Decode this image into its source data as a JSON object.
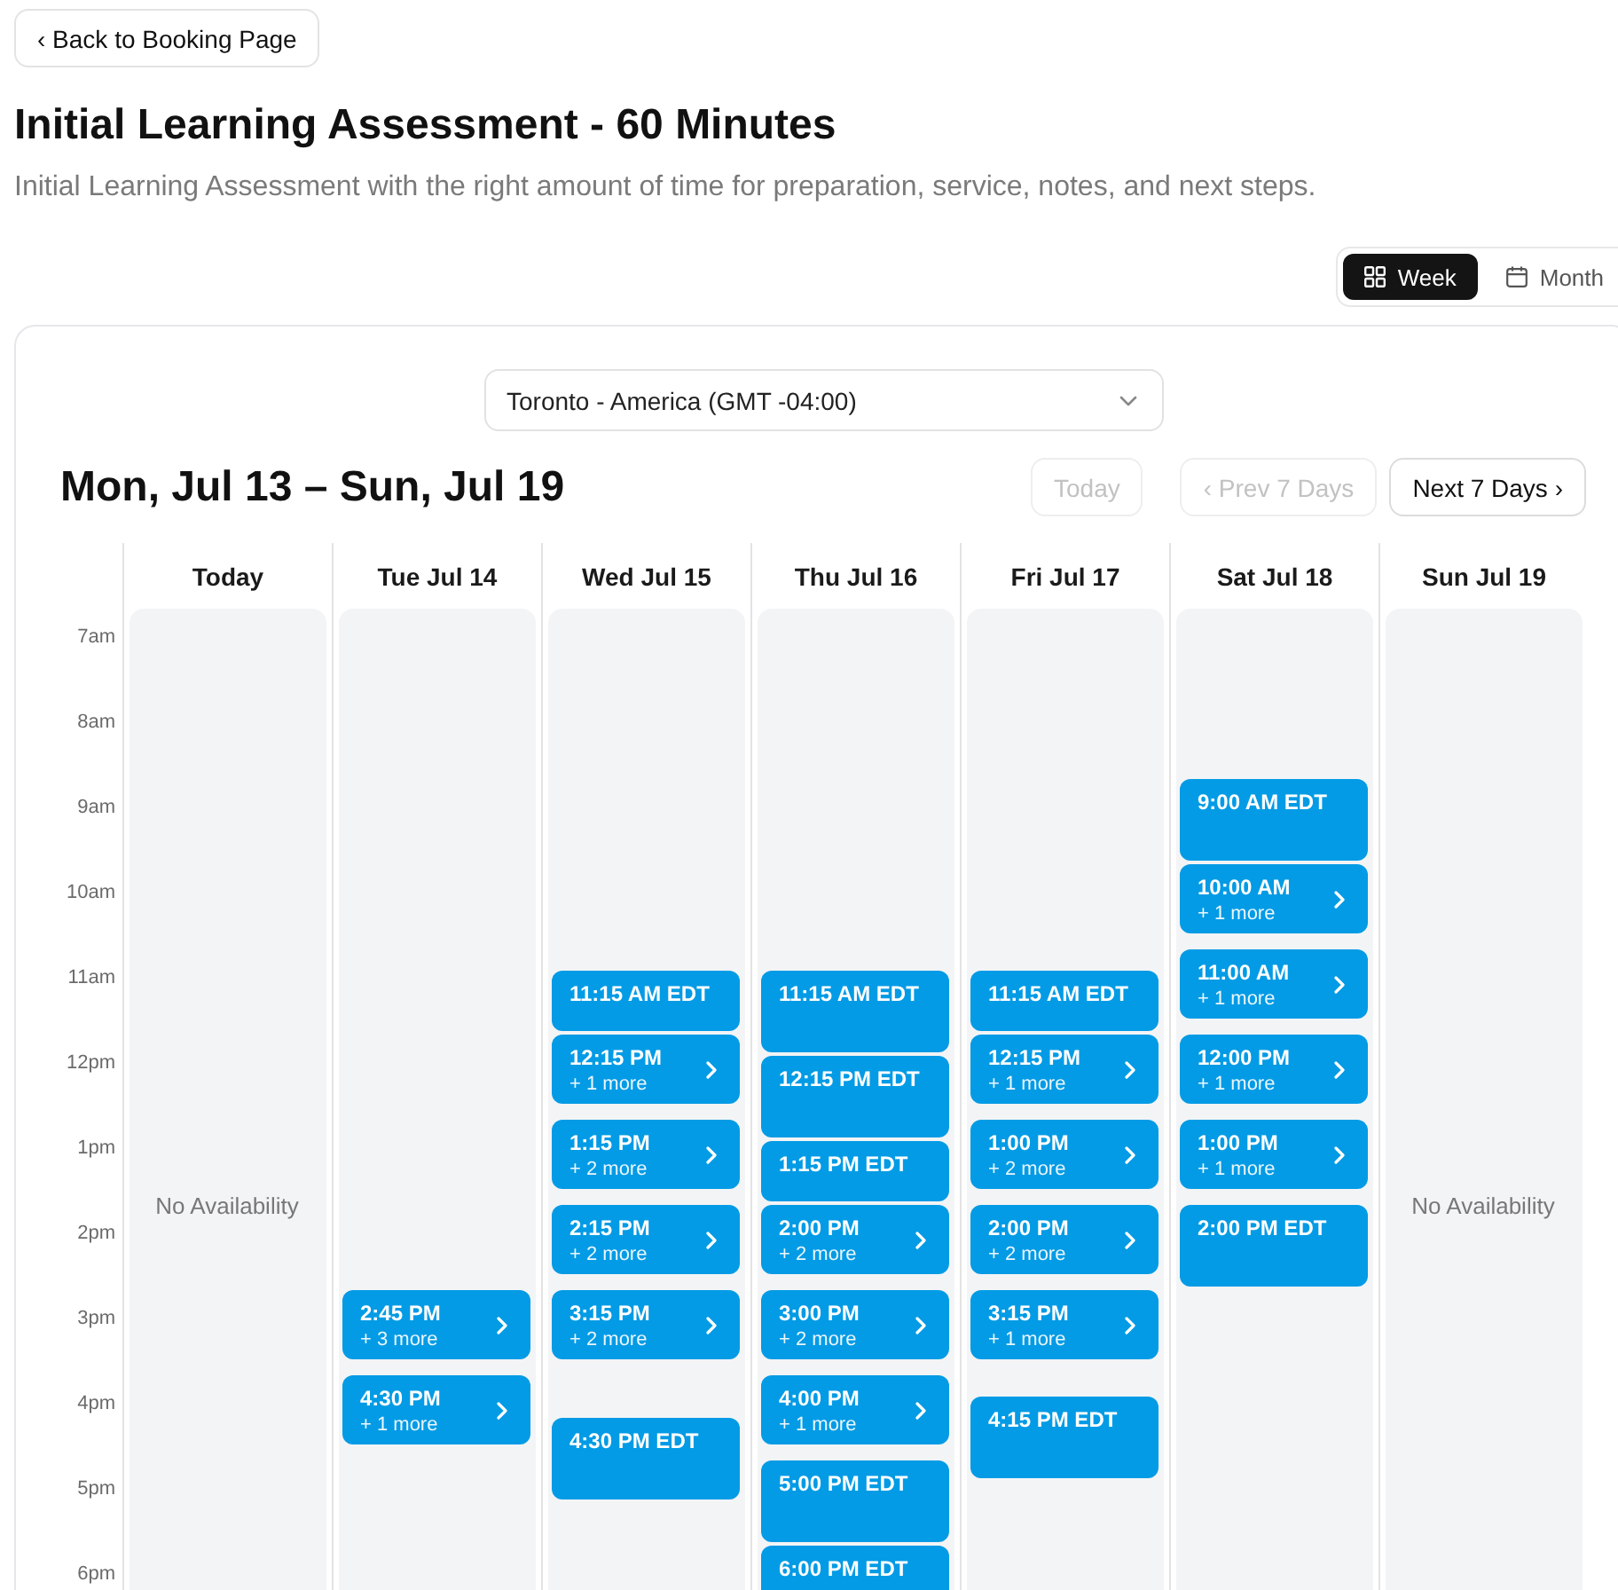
{
  "back_button": {
    "label": "‹ Back to Booking Page"
  },
  "title": "Initial Learning Assessment - 60 Minutes",
  "description": "Initial Learning Assessment with the right amount of time for preparation, service, notes, and next steps.",
  "view_toggle": [
    {
      "label": "Week",
      "selected": true
    },
    {
      "label": "Month",
      "selected": false
    }
  ],
  "calendar": {
    "timezone": {
      "value": "Toronto - America (GMT -04:00)"
    },
    "range_heading": "Mon, Jul 13 – Sun, Jul 19",
    "nav_buttons": [
      {
        "label": "Today",
        "disabled": true
      },
      {
        "label": "‹ Prev 7 Days",
        "disabled": true
      },
      {
        "label": "Next 7 Days ›",
        "disabled": false
      }
    ],
    "hours": [
      "7am",
      "8am",
      "9am",
      "10am",
      "11am",
      "12pm",
      "1pm",
      "2pm",
      "3pm",
      "4pm",
      "5pm",
      "6pm"
    ],
    "days": [
      {
        "heading": "Today",
        "empty_text": "No Availability"
      },
      {
        "heading": "Tue Jul 14",
        "slots": [
          {
            "kind": "group",
            "time": "2:45 PM",
            "more": "+ 3 more"
          },
          {
            "kind": "group",
            "time": "4:30 PM",
            "more": "+ 1 more"
          }
        ]
      },
      {
        "heading": "Wed Jul 15",
        "slots": [
          {
            "kind": "single",
            "time": "11:15 AM EDT"
          },
          {
            "kind": "group",
            "time": "12:15 PM",
            "more": "+ 1 more"
          },
          {
            "kind": "group",
            "time": "1:15 PM",
            "more": "+ 2 more"
          },
          {
            "kind": "group",
            "time": "2:15 PM",
            "more": "+ 2 more"
          },
          {
            "kind": "group",
            "time": "3:15 PM",
            "more": "+ 2 more"
          },
          {
            "kind": "single",
            "time": "4:30 PM EDT"
          }
        ]
      },
      {
        "heading": "Thu Jul 16",
        "slots": [
          {
            "kind": "single",
            "time": "11:15 AM EDT"
          },
          {
            "kind": "single",
            "time": "12:15 PM EDT"
          },
          {
            "kind": "single",
            "time": "1:15 PM EDT"
          },
          {
            "kind": "group",
            "time": "2:00 PM",
            "more": "+ 2 more"
          },
          {
            "kind": "group",
            "time": "3:00 PM",
            "more": "+ 2 more"
          },
          {
            "kind": "group",
            "time": "4:00 PM",
            "more": "+ 1 more"
          },
          {
            "kind": "single",
            "time": "5:00 PM EDT"
          },
          {
            "kind": "single",
            "time": "6:00 PM EDT"
          }
        ]
      },
      {
        "heading": "Fri Jul 17",
        "slots": [
          {
            "kind": "single",
            "time": "11:15 AM EDT"
          },
          {
            "kind": "group",
            "time": "12:15 PM",
            "more": "+ 1 more"
          },
          {
            "kind": "group",
            "time": "1:00 PM",
            "more": "+ 2 more"
          },
          {
            "kind": "group",
            "time": "2:00 PM",
            "more": "+ 2 more"
          },
          {
            "kind": "group",
            "time": "3:15 PM",
            "more": "+ 1 more"
          },
          {
            "kind": "single",
            "time": "4:15 PM EDT"
          }
        ]
      },
      {
        "heading": "Sat Jul 18",
        "slots": [
          {
            "kind": "single",
            "time": "9:00 AM EDT"
          },
          {
            "kind": "group",
            "time": "10:00 AM",
            "more": "+ 1 more"
          },
          {
            "kind": "group",
            "time": "11:00 AM",
            "more": "+ 1 more"
          },
          {
            "kind": "group",
            "time": "12:00 PM",
            "more": "+ 1 more"
          },
          {
            "kind": "group",
            "time": "1:00 PM",
            "more": "+ 1 more"
          },
          {
            "kind": "single",
            "time": "2:00 PM EDT"
          }
        ]
      },
      {
        "heading": "Sun Jul 19",
        "empty_text": "No Availability"
      }
    ]
  }
}
